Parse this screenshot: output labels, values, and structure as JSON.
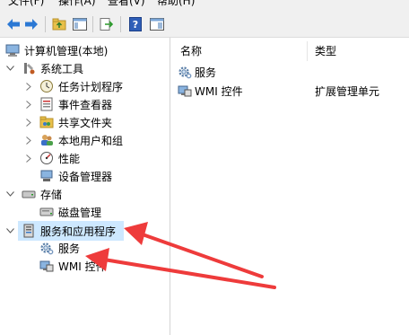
{
  "menu": [
    "文件(F)",
    "操作(A)",
    "查看(V)",
    "帮助(H)"
  ],
  "toolbar": {
    "icons": [
      "back-arrow-icon",
      "forward-arrow-icon",
      "up-folder-icon",
      "show-hide-tree-icon",
      "export-list-icon",
      "help-icon",
      "console-view-icon"
    ]
  },
  "tree": {
    "root": "计算机管理(本地)",
    "system_tools": "系统工具",
    "task_scheduler": "任务计划程序",
    "event_viewer": "事件查看器",
    "shared_folders": "共享文件夹",
    "local_users": "本地用户和组",
    "performance": "性能",
    "device_manager": "设备管理器",
    "storage": "存储",
    "disk_management": "磁盘管理",
    "services_apps": "服务和应用程序",
    "services": "服务",
    "wmi": "WMI 控件"
  },
  "list": {
    "col_name": "名称",
    "col_type": "类型",
    "rows": [
      {
        "name": "服务",
        "type": ""
      },
      {
        "name": "WMI 控件",
        "type": "扩展管理单元"
      }
    ]
  },
  "colors": {
    "selection": "#cde8ff",
    "annotation_arrow": "#ee3b3b"
  }
}
